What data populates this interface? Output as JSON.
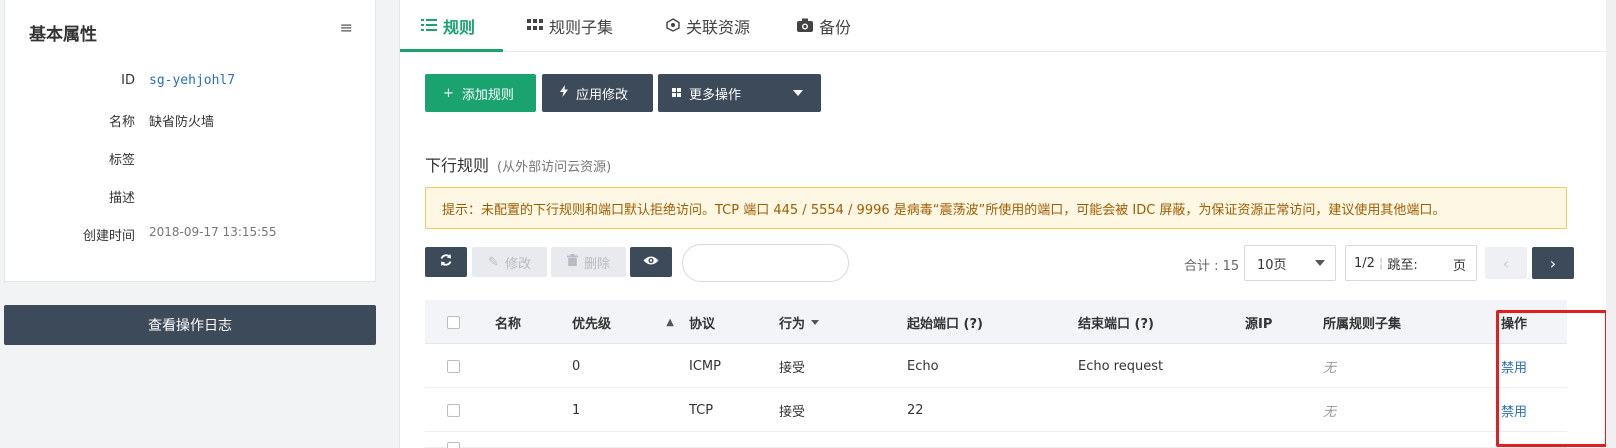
{
  "left": {
    "title": "基本属性",
    "attributes": [
      {
        "key": "ID",
        "value": "sg-yehjohl7"
      },
      {
        "key": "名称",
        "value": "缺省防火墙"
      },
      {
        "key": "标签",
        "value": ""
      },
      {
        "key": "描述",
        "value": ""
      },
      {
        "key": "创建时间",
        "value": "2018-09-17 13:15:55"
      }
    ],
    "log_button": "查看操作日志"
  },
  "tabs": [
    {
      "label": "规则",
      "icon": "list-icon",
      "active": true
    },
    {
      "label": "规则子集",
      "icon": "grid-icon",
      "active": false
    },
    {
      "label": "关联资源",
      "icon": "cube-icon",
      "active": false
    },
    {
      "label": "备份",
      "icon": "camera-icon",
      "active": false
    }
  ],
  "toolbar": {
    "add_rule": "添加规则",
    "apply_changes": "应用修改",
    "more_actions": "更多操作"
  },
  "section": {
    "title": "下行规则",
    "subtitle": "(从外部访问云资源)"
  },
  "notice": "提示：未配置的下行规则和端口默认拒绝访问。TCP 端口 445 / 5554 / 9996 是病毒“震荡波”所使用的端口，可能会被 IDC 屏蔽，为保证资源正常访问，建议使用其他端口。",
  "list_tools": {
    "edit": "修改",
    "delete": "删除",
    "search_placeholder": ""
  },
  "pagination": {
    "total": "合计 : 15",
    "page_size": "10页",
    "page_status": "1/2",
    "jump_label": "跳至:",
    "page_unit": "页"
  },
  "table": {
    "headers": [
      "名称",
      "优先级",
      "协议",
      "行为",
      "起始端口 (?)",
      "结束端口 (?)",
      "源IP",
      "所属规则子集",
      "操作"
    ],
    "rows": [
      {
        "name": "",
        "priority": "0",
        "protocol": "ICMP",
        "action": "接受",
        "start_port": "Echo",
        "end_port": "Echo request",
        "source_ip": "",
        "subset": "无",
        "op": "禁用"
      },
      {
        "name": "",
        "priority": "1",
        "protocol": "TCP",
        "action": "接受",
        "start_port": "22",
        "end_port": "",
        "source_ip": "",
        "subset": "无",
        "op": "禁用"
      }
    ]
  },
  "colors": {
    "accent_green": "#1aa36e",
    "dark_button": "#3c4a5a",
    "link_blue": "#2a6fc4",
    "highlight_red": "#e02020"
  }
}
